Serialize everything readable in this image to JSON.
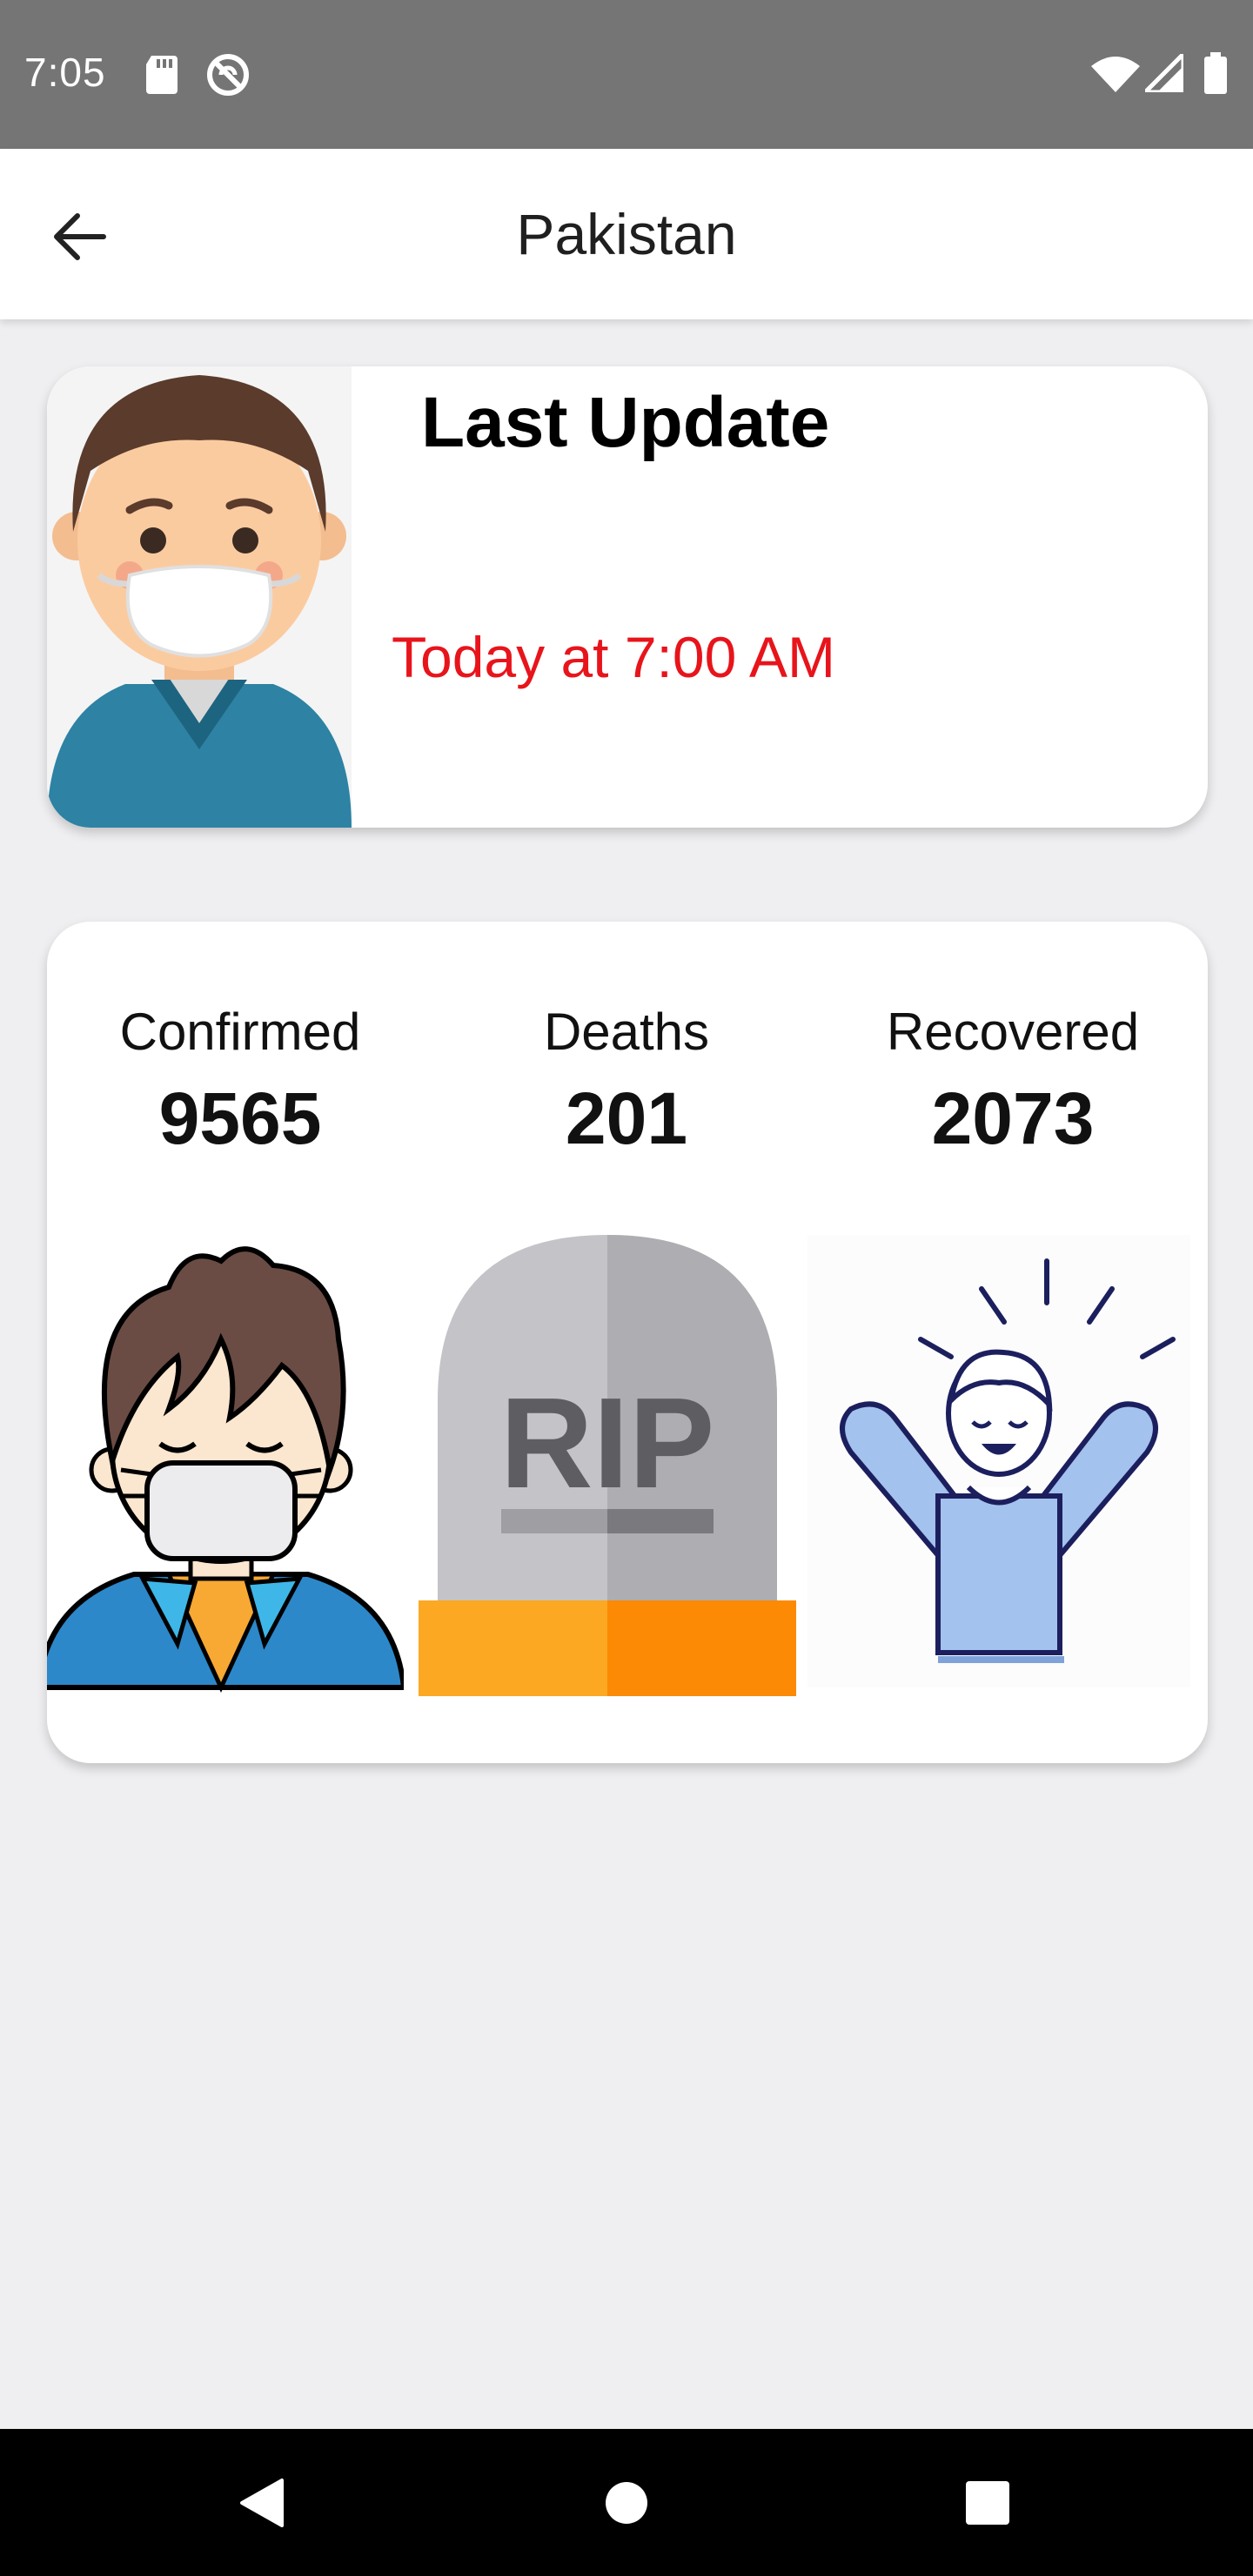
{
  "status_bar": {
    "time": "7:05",
    "icons": [
      "sd-card-icon",
      "do-not-disturb-icon",
      "wifi-icon",
      "cellular-signal-icon",
      "battery-icon"
    ]
  },
  "app_bar": {
    "title": "Pakistan",
    "back_icon": "arrow-left-icon"
  },
  "update_card": {
    "heading": "Last Update",
    "time_text": "Today at 7:00 AM",
    "time_color": "#e8141b",
    "image": "masked-man-illustration"
  },
  "stats": [
    {
      "label": "Confirmed",
      "value": "9565",
      "image": "masked-person-illustration"
    },
    {
      "label": "Deaths",
      "value": "201",
      "image": "rip-tombstone-illustration"
    },
    {
      "label": "Recovered",
      "value": "2073",
      "image": "cheering-person-illustration"
    }
  ],
  "tombstone_text": "RIP",
  "nav_bar": {
    "buttons": [
      "back-triangle-icon",
      "home-circle-icon",
      "recents-square-icon"
    ]
  }
}
